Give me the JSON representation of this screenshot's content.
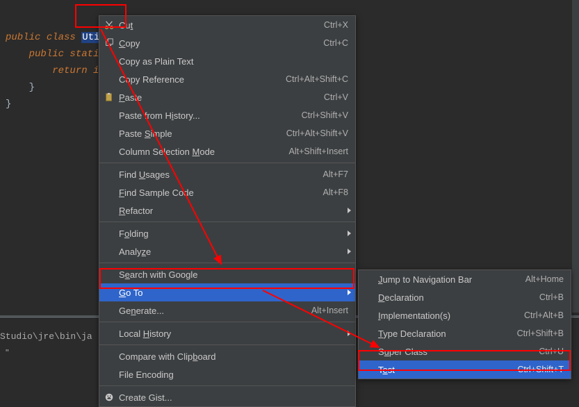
{
  "code": {
    "kw_public": "public",
    "kw_class": "class",
    "sel_util": "Util",
    "line2_a": "public stati",
    "line3_a": "return i",
    "brace": "}"
  },
  "console": {
    "text": "Studio\\jre\\bin\\ja",
    "dot": "\""
  },
  "menu": [
    {
      "label": "Cu",
      "uline": "t",
      "after": "",
      "shortcut": "Ctrl+X",
      "icon": "cut"
    },
    {
      "label": "",
      "uline": "C",
      "after": "opy",
      "shortcut": "Ctrl+C",
      "icon": "copy"
    },
    {
      "label": "Copy as Plain Text",
      "shortcut": ""
    },
    {
      "label": "Copy Reference",
      "shortcut": "Ctrl+Alt+Shift+C"
    },
    {
      "label": "",
      "uline": "P",
      "after": "aste",
      "shortcut": "Ctrl+V",
      "icon": "paste"
    },
    {
      "label": "Paste from H",
      "uline": "i",
      "after": "story...",
      "shortcut": "Ctrl+Shift+V"
    },
    {
      "label": "Paste ",
      "uline": "S",
      "after": "imple",
      "shortcut": "Ctrl+Alt+Shift+V"
    },
    {
      "label": "Column Selection ",
      "uline": "M",
      "after": "ode",
      "shortcut": "Alt+Shift+Insert"
    },
    {
      "sep": true
    },
    {
      "label": "Find ",
      "uline": "U",
      "after": "sages",
      "shortcut": "Alt+F7"
    },
    {
      "label": "",
      "uline": "F",
      "after": "ind Sample Code",
      "shortcut": "Alt+F8"
    },
    {
      "label": "",
      "uline": "R",
      "after": "efactor",
      "submenu": true
    },
    {
      "sep": true
    },
    {
      "label": "F",
      "uline": "o",
      "after": "lding",
      "submenu": true
    },
    {
      "label": "Analy",
      "uline": "z",
      "after": "e",
      "submenu": true
    },
    {
      "sep": true
    },
    {
      "label": "S",
      "uline": "e",
      "after": "arch with Google"
    },
    {
      "label": "",
      "uline": "G",
      "after": "o To",
      "hl": true,
      "submenu": true
    },
    {
      "label": "Ge",
      "uline": "n",
      "after": "erate...",
      "shortcut": "Alt+Insert"
    },
    {
      "sep": true
    },
    {
      "label": "Local ",
      "uline": "H",
      "after": "istory",
      "submenu": true
    },
    {
      "sep": true
    },
    {
      "label": "Compare with Clip",
      "uline": "b",
      "after": "oard"
    },
    {
      "label": "File Encoding"
    },
    {
      "sep": true
    },
    {
      "label": "Create Gist...",
      "icon": "gist"
    }
  ],
  "submenu": [
    {
      "label": "",
      "uline": "J",
      "after": "ump to Navigation Bar",
      "shortcut": "Alt+Home"
    },
    {
      "label": "",
      "uline": "D",
      "after": "eclaration",
      "shortcut": "Ctrl+B"
    },
    {
      "label": "",
      "uline": "I",
      "after": "mplementation(s)",
      "shortcut": "Ctrl+Alt+B"
    },
    {
      "label": "",
      "uline": "T",
      "after": "ype Declaration",
      "shortcut": "Ctrl+Shift+B"
    },
    {
      "label": "S",
      "uline": "u",
      "after": "per Class",
      "shortcut": "Ctrl+U"
    },
    {
      "label": "T",
      "uline": "e",
      "after": "st",
      "shortcut": "Ctrl+Shift+T",
      "hl": true
    }
  ]
}
